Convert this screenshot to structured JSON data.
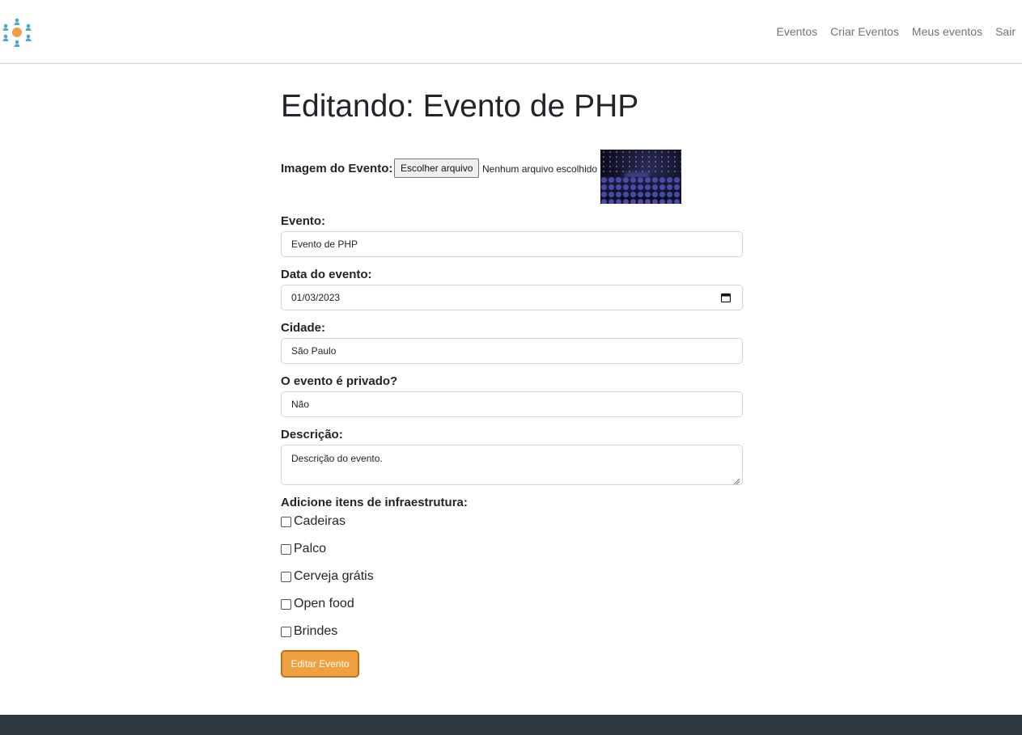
{
  "nav": {
    "items": [
      "Eventos",
      "Criar Eventos",
      "Meus eventos",
      "Sair"
    ]
  },
  "page": {
    "title": "Editando: Evento de PHP"
  },
  "form": {
    "image": {
      "label": "Imagem do Evento:",
      "button": "Escolher arquivo",
      "status": "Nenhum arquivo escolhido"
    },
    "event": {
      "label": "Evento:",
      "value": "Evento de PHP"
    },
    "date": {
      "label": "Data do evento:",
      "value": "01/03/2023"
    },
    "city": {
      "label": "Cidade:",
      "value": "São Paulo"
    },
    "private": {
      "label": "O evento é privado?",
      "value": "Não"
    },
    "description": {
      "label": "Descrição:",
      "value": "Descrição do evento."
    },
    "infra": {
      "title": "Adicione itens de infraestrutura:",
      "items": [
        "Cadeiras",
        "Palco",
        "Cerveja grátis",
        "Open food",
        "Brindes"
      ]
    },
    "submit": "Editar Evento"
  },
  "colors": {
    "accent": "#f0a040",
    "footer": "#2f3741",
    "logo_center": "#f0a040",
    "logo_people": "#4aa8c8"
  }
}
